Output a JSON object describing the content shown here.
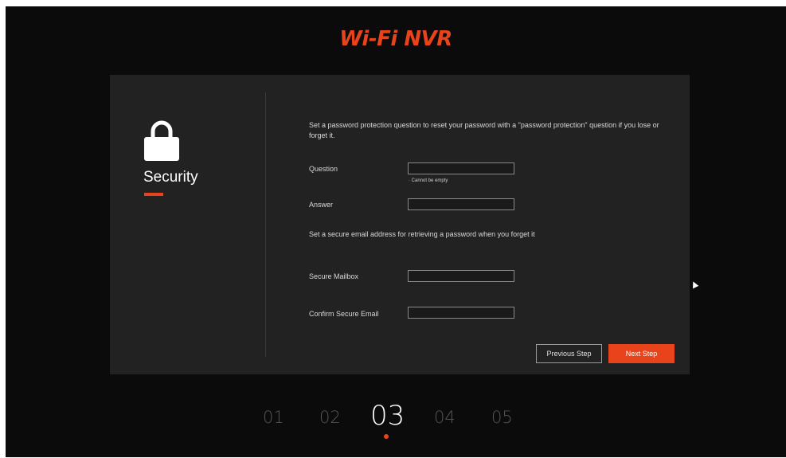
{
  "brand": {
    "logo_text": "Wi-Fi NVR",
    "accent_color": "#e8431b"
  },
  "sidebar": {
    "icon": "lock-icon",
    "title": "Security"
  },
  "form": {
    "intro": "Set a password protection question to reset your password with a \"password protection\" question if you lose or forget it.",
    "question_label": "Question",
    "question_value": "",
    "question_hint": "· Cannot be empty",
    "answer_label": "Answer",
    "answer_value": "",
    "email_intro": "Set a secure email address for retrieving a password when you forget it",
    "mailbox_label": "Secure Mailbox",
    "mailbox_value": "",
    "confirm_label": "Confirm Secure Email",
    "confirm_value": ""
  },
  "buttons": {
    "previous": "Previous Step",
    "next": "Next Step"
  },
  "steps": {
    "items": [
      "01",
      "02",
      "03",
      "04",
      "05"
    ],
    "active": "03"
  }
}
